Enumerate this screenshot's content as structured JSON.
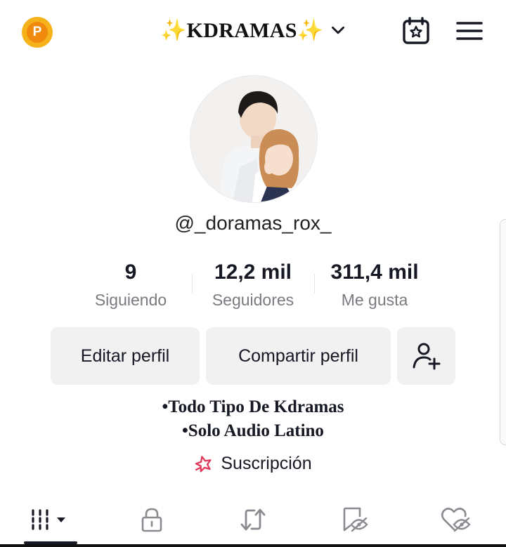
{
  "header": {
    "coin_letter": "P",
    "title": "✨KDRAMAS✨",
    "calendar_icon": "calendar-star-icon",
    "menu_icon": "hamburger-menu-icon"
  },
  "profile": {
    "username": "@_doramas_rox_",
    "stats": [
      {
        "value": "9",
        "label": "Siguiendo"
      },
      {
        "value": "12,2 mil",
        "label": "Seguidores"
      },
      {
        "value": "311,4 mil",
        "label": "Me gusta"
      }
    ]
  },
  "actions": {
    "edit_label": "Editar perfil",
    "share_label": "Compartir perfil",
    "add_friend_icon": "add-user-icon"
  },
  "bio": {
    "line1": "•Todo Tipo De Kdramas",
    "line2": "•Solo Audio Latino",
    "subscription_label": "Suscripción"
  },
  "tabs": [
    {
      "icon": "videos-grid-icon",
      "active": true
    },
    {
      "icon": "lock-icon",
      "active": false
    },
    {
      "icon": "repost-icon",
      "active": false
    },
    {
      "icon": "bookmark-hidden-icon",
      "active": false
    },
    {
      "icon": "liked-hidden-icon",
      "active": false
    }
  ],
  "colors": {
    "coin_outer": "#f6b21a",
    "coin_inner": "#ef8a0f",
    "button_bg": "#f1f1f2",
    "muted_text": "#7a7b81",
    "subscription_icon": "#e0385a"
  }
}
